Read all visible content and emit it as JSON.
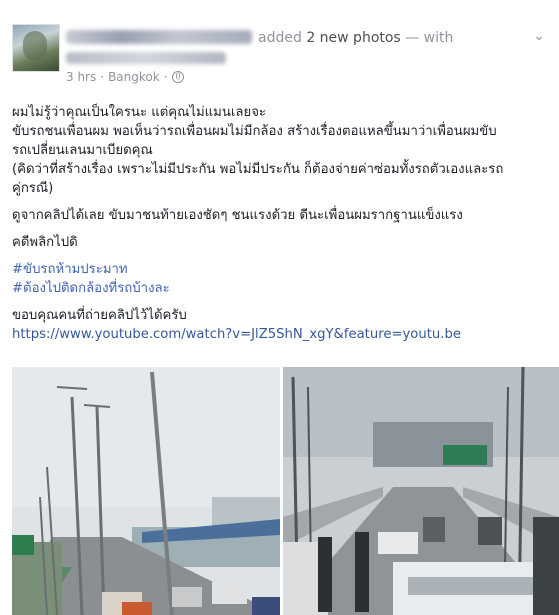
{
  "post": {
    "author_action": "added",
    "action_detail": "2 new photos",
    "with_text": "— with",
    "time": "3 hrs",
    "separator": "·",
    "location": "Bangkok",
    "privacy_icon": "globe-icon",
    "menu_icon": "chevron-down-icon",
    "lines": [
      "ผมไม่รู้ว่าคุณเป็นใครนะ แต่คุณไม่แมนเลยจะ",
      "ขับรถชนเพื่อนผม พอเห็นว่ารถเพื่อนผมไม่มีกล้อง สร้างเรื่องตอแหลขึ้นมาว่าเพื่อนผมขับ",
      "รถเปลี่ยนเลนมาเบียดคุณ",
      "(คิดว่าที่สร้างเรื่อง เพราะไม่มีประกัน พอไม่มีประกัน ก็ต้องจ่ายค่าซ่อมทั้งรถตัวเองและรถ",
      "คู่กรณี)",
      "ดูจากคลิปได้เลย ขับมาชนท้ายเองชัดๆ ชนแรงด้วย ดีนะเพื่อนผมรากฐานแข็งแรง",
      "คดีพลิกไปดิ"
    ],
    "hashtags": [
      "#ขับรถห้ามประมาท",
      "#ต้องไปติดกล้องที่รถบ้างละ"
    ],
    "thanks": "ขอบคุณคนที่ถ่ายคลิปไว้ได้ครับ",
    "link": "https://www.youtube.com/watch?v=JlZ5ShN_xgY&feature=youtu.be"
  },
  "colors": {
    "meta": "#90949c",
    "hashtag": "#4267b2",
    "link": "#365899",
    "text": "#1d2129"
  }
}
